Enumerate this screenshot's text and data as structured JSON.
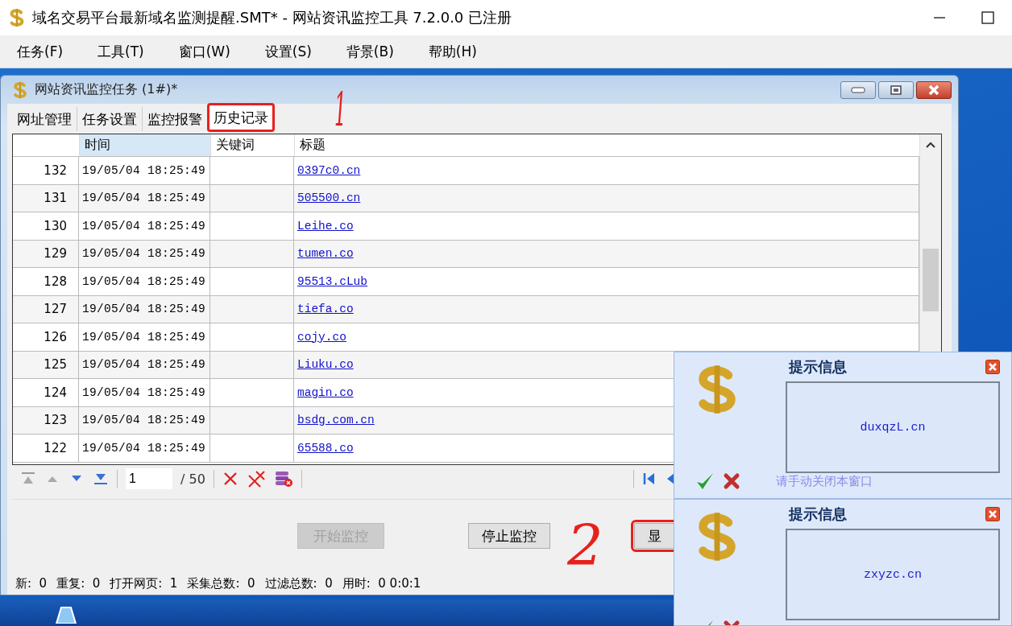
{
  "window": {
    "title": "域名交易平台最新域名监测提醒.SMT* - 网站资讯监控工具 7.2.0.0  已注册"
  },
  "menu": [
    "任务(F)",
    "工具(T)",
    "窗口(W)",
    "设置(S)",
    "背景(B)",
    "帮助(H)"
  ],
  "task_window": {
    "title": "网站资讯监控任务  (1#)*",
    "tabs": [
      {
        "label": "网址管理",
        "selected": false,
        "highlighted": false
      },
      {
        "label": "任务设置",
        "selected": false,
        "highlighted": false
      },
      {
        "label": "监控报警",
        "selected": false,
        "highlighted": false
      },
      {
        "label": "历史记录",
        "selected": true,
        "highlighted": true
      }
    ],
    "table": {
      "columns": [
        {
          "label": "时间",
          "selected": true
        },
        {
          "label": "关键词",
          "selected": false
        },
        {
          "label": "标题",
          "selected": false
        }
      ],
      "rows": [
        {
          "number": "132",
          "time": "19/05/04 18:25:49",
          "title": "0397c0.cn"
        },
        {
          "number": "131",
          "time": "19/05/04 18:25:49",
          "title": "505500.cn"
        },
        {
          "number": "130",
          "time": "19/05/04 18:25:49",
          "title": "Leihe.co"
        },
        {
          "number": "129",
          "time": "19/05/04 18:25:49",
          "title": "tumen.co"
        },
        {
          "number": "128",
          "time": "19/05/04 18:25:49",
          "title": "95513.cLub"
        },
        {
          "number": "127",
          "time": "19/05/04 18:25:49",
          "title": "tiefa.co"
        },
        {
          "number": "126",
          "time": "19/05/04 18:25:49",
          "title": "cojy.co"
        },
        {
          "number": "125",
          "time": "19/05/04 18:25:49",
          "title": "Liuku.co"
        },
        {
          "number": "124",
          "time": "19/05/04 18:25:49",
          "title": "magin.co"
        },
        {
          "number": "123",
          "time": "19/05/04 18:25:49",
          "title": "bsdg.com.cn"
        },
        {
          "number": "122",
          "time": "19/05/04 18:25:49",
          "title": "65588.co"
        }
      ]
    },
    "pager": {
      "page": "1",
      "total": "/ 50"
    },
    "buttons": [
      {
        "label": "开始监控",
        "disabled": true,
        "highlighted": false
      },
      {
        "label": "停止监控",
        "disabled": false,
        "highlighted": false
      },
      {
        "label": "显",
        "disabled": false,
        "highlighted": true
      }
    ],
    "status_bar": [
      "新:  0",
      "重复:  0",
      "打开网页:  1",
      "采集总数:  0",
      "过滤总数:  0",
      "用时:  0 0:0:1"
    ]
  },
  "popups": [
    {
      "title": "提示信息",
      "message": "duxqzL.cn",
      "footer": "请手动关闭本窗口"
    },
    {
      "title": "提示信息",
      "message": "zxyzc.cn"
    }
  ],
  "annotations": [
    {
      "text": "1"
    },
    {
      "text": "2"
    }
  ]
}
